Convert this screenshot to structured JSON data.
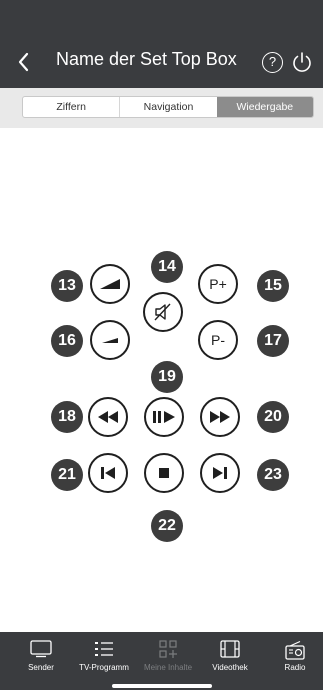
{
  "header": {
    "title": "Name der Set Top Box",
    "back_icon": "chevron-left-icon",
    "help_label": "?",
    "power_icon": "power-icon"
  },
  "segmented": {
    "tabs": [
      "Ziffern",
      "Navigation",
      "Wiedergabe"
    ],
    "active": "Wiedergabe"
  },
  "remote": {
    "buttons": {
      "volume_up": "volume-up-icon",
      "mute": "mute-icon",
      "program_up": "P+",
      "volume_down": "volume-down-icon",
      "program_down": "P-",
      "rewind": "rewind-icon",
      "play_pause": "play-pause-icon",
      "fast_forward": "fast-forward-icon",
      "skip_back": "skip-back-icon",
      "stop": "stop-icon",
      "skip_forward": "skip-forward-icon"
    },
    "callouts": [
      "13",
      "14",
      "15",
      "16",
      "17",
      "18",
      "19",
      "20",
      "21",
      "22",
      "23"
    ]
  },
  "tabbar": {
    "items": [
      {
        "label": "Sender",
        "icon": "tv-icon"
      },
      {
        "label": "TV-Programm",
        "icon": "list-icon"
      },
      {
        "label": "Meine Inhalte",
        "icon": "grid-plus-icon"
      },
      {
        "label": "Videothek",
        "icon": "film-icon"
      },
      {
        "label": "Radio",
        "icon": "radio-icon"
      }
    ]
  },
  "colors": {
    "header_bg": "#3a3c3f",
    "active_segment": "#8c8c8c",
    "callout_bg": "#3d3d3d"
  }
}
